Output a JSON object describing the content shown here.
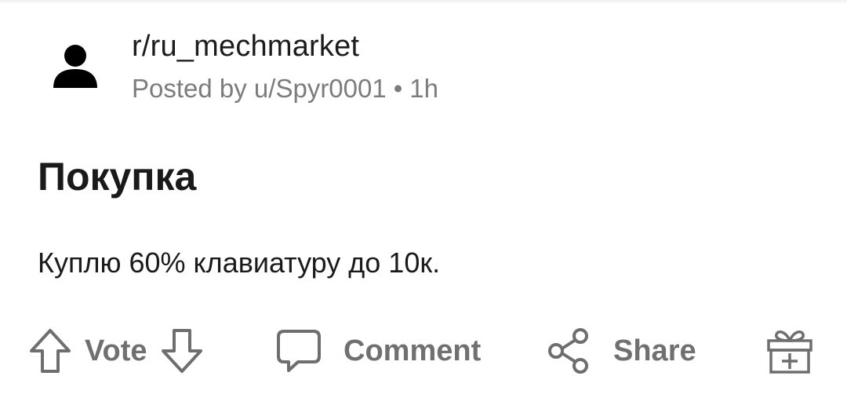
{
  "post": {
    "subreddit": "r/ru_mechmarket",
    "posted_by": "Posted by u/Spyr0001",
    "separator": "•",
    "age": "1h",
    "title": "Покупка",
    "body": "Куплю 60% клавиатуру до 10к."
  },
  "actions": {
    "vote_label": "Vote",
    "comment_label": "Comment",
    "share_label": "Share"
  },
  "icons": {
    "avatar": "user-avatar-icon",
    "upvote": "arrow-up-outline-icon",
    "downvote": "arrow-down-outline-icon",
    "comment": "speech-bubble-icon",
    "share": "share-nodes-icon",
    "award": "gift-box-icon"
  },
  "colors": {
    "text_primary": "#1a1a1a",
    "text_secondary": "#7c7c7c",
    "action_gray": "#707070"
  }
}
